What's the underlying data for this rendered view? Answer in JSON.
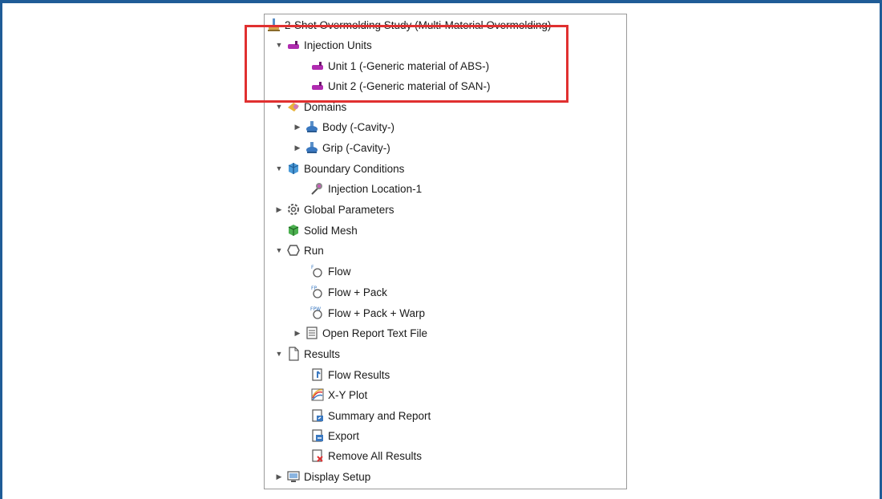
{
  "colors": {
    "frame": "#1f5c97",
    "highlight": "#e03030"
  },
  "tree": {
    "root": {
      "label": "2-Shot Overmolding Study (Multi-Material Overmolding)",
      "icon": "study-icon"
    },
    "injection_units": {
      "label": "Injection Units",
      "icon": "injection-unit-icon",
      "expanded": true
    },
    "unit1": {
      "label": "Unit 1 (-Generic material of ABS-)",
      "icon": "injection-unit-icon"
    },
    "unit2": {
      "label": "Unit 2 (-Generic material of SAN-)",
      "icon": "injection-unit-icon"
    },
    "domains": {
      "label": "Domains",
      "icon": "domains-icon",
      "expanded": true
    },
    "body": {
      "label": "Body (-Cavity-)",
      "icon": "cavity-icon",
      "expanded": false
    },
    "grip": {
      "label": "Grip (-Cavity-)",
      "icon": "cavity-icon",
      "expanded": false
    },
    "boundary": {
      "label": "Boundary Conditions",
      "icon": "boundary-conditions-icon",
      "expanded": true
    },
    "injection_location": {
      "label": "Injection Location-1",
      "icon": "injection-location-icon"
    },
    "global_params": {
      "label": "Global Parameters",
      "icon": "gear-icon",
      "expanded": false
    },
    "solid_mesh": {
      "label": "Solid Mesh",
      "icon": "mesh-icon"
    },
    "run": {
      "label": "Run",
      "icon": "run-icon",
      "expanded": true
    },
    "flow": {
      "label": "Flow",
      "icon": "flow-icon"
    },
    "flow_pack": {
      "label": "Flow + Pack",
      "icon": "flow-pack-icon"
    },
    "flow_pack_warp": {
      "label": "Flow + Pack + Warp",
      "icon": "flow-pack-warp-icon"
    },
    "open_report": {
      "label": "Open Report Text File",
      "icon": "text-file-icon",
      "expanded": false
    },
    "results": {
      "label": "Results",
      "icon": "document-icon",
      "expanded": true
    },
    "flow_results": {
      "label": "Flow Results",
      "icon": "flow-results-icon"
    },
    "xy_plot": {
      "label": "X-Y Plot",
      "icon": "xy-plot-icon"
    },
    "summary": {
      "label": "Summary and Report",
      "icon": "summary-report-icon"
    },
    "export": {
      "label": "Export",
      "icon": "export-icon"
    },
    "remove_all": {
      "label": "Remove All Results",
      "icon": "remove-results-icon"
    },
    "display_setup": {
      "label": "Display Setup",
      "icon": "display-setup-icon",
      "expanded": false
    }
  }
}
